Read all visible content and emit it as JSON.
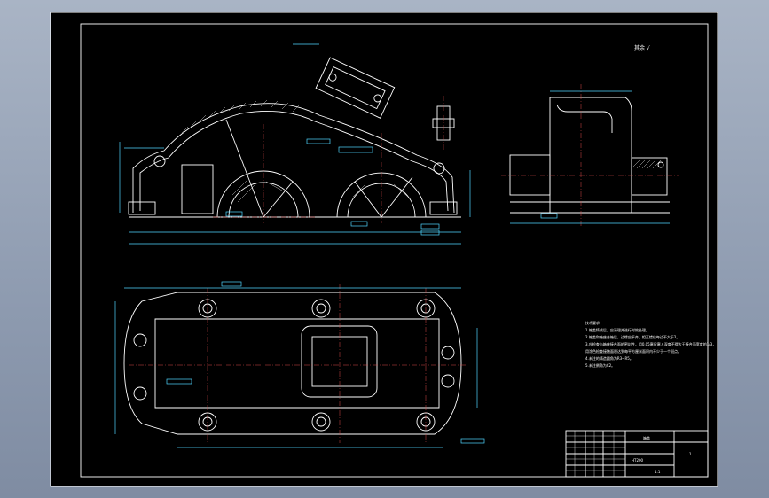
{
  "document": {
    "roughness_symbol": "其余 √"
  },
  "colors": {
    "background": "#8e9bb0",
    "sheet": "#000000",
    "outline": "#ffffff",
    "dimension": "#4fd6ff",
    "centerline": "#d94a4a",
    "hatch": "#ffffff"
  },
  "title_block": {
    "drawing_name": "箱盖",
    "material": "HT200",
    "scale": "1:1",
    "sheet_no": "1"
  },
  "technical_notes": {
    "heading": "技术要求",
    "lines": [
      "1.箱盖铸成后，应清理并进行时效处理。",
      "2.箱盖和箱座合箱后，边缘应平齐，相互错位每边不大于2。",
      "3.应检查与箱座接合面的密封性，用0.05塞尺塞入深度不得大于接合面宽度的1/3，",
      "   用涂色检查接触面积达到每平方厘米面积内不少于一个斑点。",
      "4.未注的铸造圆角为R3~R5。",
      "5.未注倒角为C2。"
    ]
  }
}
